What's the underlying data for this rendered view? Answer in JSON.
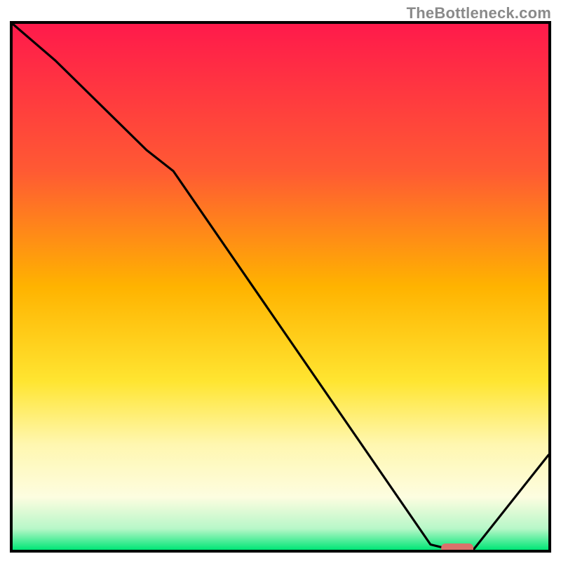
{
  "watermark": "TheBottleneck.com",
  "chart_data": {
    "type": "line",
    "title": "",
    "xlabel": "",
    "ylabel": "",
    "xlim": [
      0,
      100
    ],
    "ylim": [
      0,
      100
    ],
    "gradient_stops": [
      {
        "offset": 0,
        "color": "#ff1a4b"
      },
      {
        "offset": 28,
        "color": "#ff5a33"
      },
      {
        "offset": 50,
        "color": "#ffb300"
      },
      {
        "offset": 68,
        "color": "#ffe531"
      },
      {
        "offset": 80,
        "color": "#fff7b0"
      },
      {
        "offset": 90,
        "color": "#fdfde0"
      },
      {
        "offset": 96,
        "color": "#b7f7c8"
      },
      {
        "offset": 100,
        "color": "#00e676"
      }
    ],
    "series": [
      {
        "name": "bottleneck-curve",
        "x": [
          0,
          8,
          25,
          30,
          78,
          82,
          86,
          100
        ],
        "values": [
          100,
          93,
          76,
          72,
          1,
          0,
          0,
          18
        ]
      }
    ],
    "marker": {
      "name": "optimal-marker",
      "x_start": 80,
      "x_end": 86,
      "y": 0,
      "color": "#d9726b"
    }
  }
}
